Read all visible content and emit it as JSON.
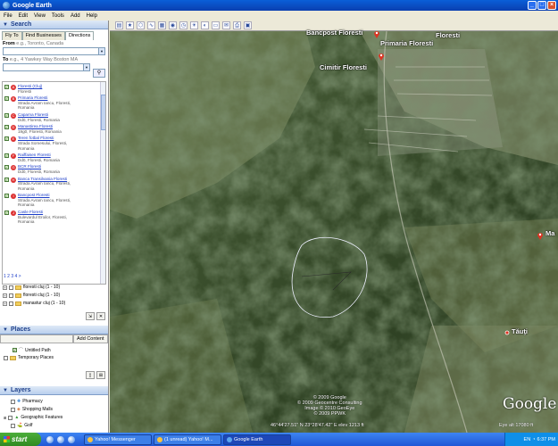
{
  "window": {
    "title": "Google Earth",
    "controls": [
      "_",
      "□",
      "×"
    ]
  },
  "menu": [
    "File",
    "Edit",
    "View",
    "Tools",
    "Add",
    "Help"
  ],
  "search": {
    "header": "Search",
    "tabs": [
      "Fly To",
      "Find Businesses",
      "Directions"
    ],
    "from_label": "From",
    "from_placeholder": "e.g., Toronto, Canada",
    "to_label": "To",
    "to_placeholder": "e.g., 4 Yawkey Way Boston MA",
    "results": [
      {
        "letter": "A",
        "title": "Floresti (Cluj)",
        "lines": [
          "Floresti"
        ]
      },
      {
        "letter": "B",
        "title": "Primaria Floresti",
        "lines": [
          "Strada Avram Iancu, Floresti,",
          "Romania"
        ]
      },
      {
        "letter": "C",
        "title": "Caparna Floresti",
        "lines": [
          "Dd0, Floresti, Romania"
        ]
      },
      {
        "letter": "D",
        "title": "Manastirea Floresti",
        "lines": [
          "19g0, Floresti, Romania"
        ]
      },
      {
        "letter": "E",
        "title": "Teren fotbal Floresti",
        "lines": [
          "Strada Somesului, Floresti,",
          "Romania"
        ]
      },
      {
        "letter": "F",
        "title": "Raiffaisen Floresti",
        "lines": [
          "Dd0, Floresti, Romania"
        ]
      },
      {
        "letter": "G",
        "title": "BCR Floresti",
        "lines": [
          "Dd0, Floresti, Romania"
        ]
      },
      {
        "letter": "H",
        "title": "Banca Transilvania Floresti",
        "lines": [
          "Strada Avram Iancu, Floresti,",
          "Romania"
        ]
      },
      {
        "letter": "I",
        "title": "Bancpost Floresti",
        "lines": [
          "Strada Avram Iancu, Floresti,",
          "Romania"
        ]
      },
      {
        "letter": "J",
        "title": "Casle Floresti",
        "lines": [
          "Bulevardul Eroilor, Floresti,",
          "Romania"
        ]
      }
    ],
    "pager": "1 2 3 4 >",
    "tree": [
      "floresti cluj (1 - 10)",
      "floresti cluj (1 - 10)",
      "manastur cluj (1 - 10)"
    ]
  },
  "places": {
    "header": "Places",
    "add_content": "Add Content",
    "items": [
      "Untitled Path",
      "Temporary Places"
    ]
  },
  "layers": {
    "header": "Layers",
    "items": [
      "Pharmacy",
      "Shopping Malls",
      "Geographic Features",
      "Golf"
    ]
  },
  "map": {
    "labels": {
      "bancpost": "Bancpost Floresti",
      "primaria": "Primaria Floresti",
      "floresti": "Floresti",
      "cimitir": "Cimitir Floresti",
      "ma": "Ma",
      "tauti": "Tăuţi"
    },
    "copyright": [
      "© 2009 Google",
      "© 2009 Geocentre Consulting",
      "Image © 2010 GeoEye",
      "© 2009 PPWK"
    ],
    "coords": "46°44'27.51\" N     23°28'47.42\" E     elev  1213 ft",
    "eye_alt": "Eye alt   17080 ft",
    "logo": "Google"
  },
  "taskbar": {
    "start": "start",
    "tasks": [
      "Yahoo! Messenger",
      "(1 unread) Yahoo! M...",
      "Google Earth"
    ],
    "tray": [
      "EN",
      "6:37 PM"
    ]
  }
}
